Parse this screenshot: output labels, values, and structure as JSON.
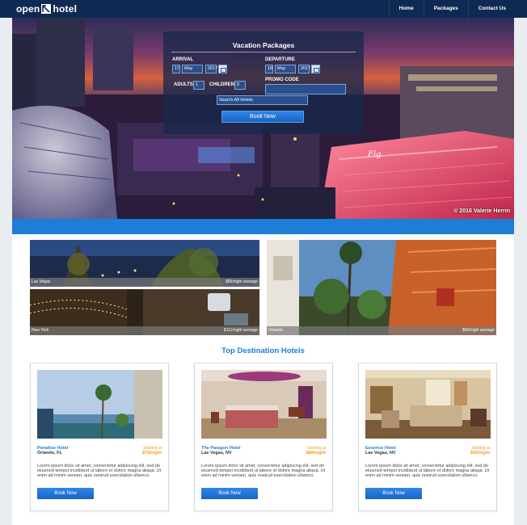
{
  "brand": {
    "logo_left": "open",
    "logo_right": "hotel"
  },
  "nav": [
    "Home",
    "Packages",
    "Contact Us"
  ],
  "hero": {
    "credit": "© 2016 Valerie Herrin",
    "booking": {
      "title": "Vacation Packages",
      "arrival_label": "ARRIVAL",
      "arrival_day": "17",
      "arrival_month": "May",
      "arrival_year": "2017",
      "departure_label": "DEPARTURE",
      "departure_day": "18",
      "departure_month": "May",
      "departure_year": "2017",
      "adults_label": "ADULTS",
      "adults_value": "1",
      "children_label": "CHILDREN",
      "children_value": "0",
      "promo_label": "PROMO CODE",
      "promo_value": "",
      "search_all": "Search All Hotels",
      "book_label": "Book Now"
    }
  },
  "tiles": [
    {
      "city": "Las Vegas",
      "rate": "$85/night average"
    },
    {
      "city": "New York",
      "rate": "$111/night average"
    },
    {
      "city": "Orlando",
      "rate": "$65/night average"
    }
  ],
  "section_title": "Top Destination Hotels",
  "hotels": [
    {
      "name": "Paradise Hotel",
      "location": "Orlando, FL",
      "starting": "Starting at",
      "price": "$79/night",
      "description": "Lorem ipsum dolor sit amet, consectetur adipiscing elit, sed do eiusmod tempor incididunt ut labore et dolore magna aliqua. Ut enim ad minim veniam, quis nostrud exercitation ullamco.",
      "button": "Book Now"
    },
    {
      "name": "The Paragon Hotel",
      "location": "Las Vegas, NV",
      "starting": "Starting at",
      "price": "$88/night",
      "description": "Lorem ipsum dolor sit amet, consectetur adipiscing elit, sed do eiusmod tempor incididunt ut labore et dolore magna aliqua. Ut enim ad minim veniam, quis nostrud exercitation ullamco.",
      "button": "Book Now"
    },
    {
      "name": "Essence Hotel",
      "location": "Las Vegas, NV",
      "starting": "Starting at",
      "price": "$90/night",
      "description": "Lorem ipsum dolor sit amet, consectetur adipiscing elit, sed do eiusmod tempor incididunt ut labore et dolore magna aliqua. Ut enim ad minim veniam, quis nostrud exercitation ullamco.",
      "button": "Book Now"
    }
  ]
}
